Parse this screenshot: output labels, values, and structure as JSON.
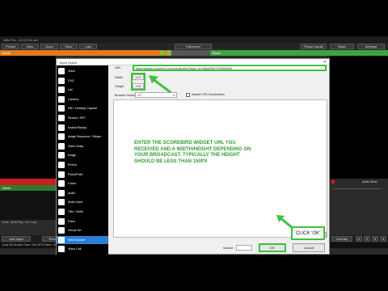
{
  "app": {
    "title": "vMix Pro - 19.0.0.54 x64",
    "toolbar": [
      "Preset",
      "New",
      "Open",
      "Save",
      "Last"
    ],
    "fullscreen_label": "Fullscreen",
    "right_toolbar": [
      "Pause Inputs",
      "Basic",
      "Settings"
    ],
    "preview_header": "Blank",
    "output_header": "Blank",
    "status_text": "(ms) 25 Render Time: 2ms GPU Mem: 7% CPU vMix: 1% Total: 7%",
    "colors": {
      "green": "#3ec13e",
      "orange": "#e07a1e",
      "select_blue": "#2b7ed6"
    }
  },
  "dialog": {
    "title": "Input Select",
    "input_types": [
      {
        "label": "Video",
        "icon": "film-icon"
      },
      {
        "label": "DVD",
        "icon": "disc-icon"
      },
      {
        "label": "List",
        "icon": "list-icon"
      },
      {
        "label": "Camera",
        "icon": "camera-icon"
      },
      {
        "label": "NDI / Desktop Capture",
        "icon": "monitor-icon"
      },
      {
        "label": "Stream / SRT",
        "icon": "stream-icon"
      },
      {
        "label": "Instant Replay",
        "icon": "replay-icon"
      },
      {
        "label": "Image Sequence / Slinger",
        "icon": "images-icon"
      },
      {
        "label": "Video Delay",
        "icon": "clock-icon"
      },
      {
        "label": "Image",
        "icon": "image-icon"
      },
      {
        "label": "Photos",
        "icon": "photos-icon"
      },
      {
        "label": "PowerPoint",
        "icon": "powerpoint-icon"
      },
      {
        "label": "Colour",
        "icon": "colour-icon"
      },
      {
        "label": "Audio",
        "icon": "audio-icon"
      },
      {
        "label": "Audio Input",
        "icon": "mic-icon"
      },
      {
        "label": "Title / XAML",
        "icon": "title-icon"
      },
      {
        "label": "Flash",
        "icon": "flash-icon"
      },
      {
        "label": "Virtual Set",
        "icon": "virtualset-icon"
      },
      {
        "label": "Web Browser",
        "icon": "globe-icon",
        "selected": true
      },
      {
        "label": "Video Call",
        "icon": "videocall-icon"
      }
    ],
    "url_label": "URL",
    "url_value": "https://widget.scorebird.com/overlay.html?team_id=2f8ad20677f10f3093a0",
    "width_label": "Width",
    "width_value": "1920",
    "height_label": "Height",
    "height_value": "1080",
    "browser_version_label": "Browser Version",
    "browser_version_value": "v77",
    "gpu_accel_label": "Disable GPU Acceleration",
    "clear_label": "Clear",
    "number_label": "Number",
    "ok_label": "OK",
    "cancel_label": "Cancel"
  },
  "annotations": {
    "note": "ENTER THE SCOREBIRD WIDGET URL YOU RECEIVED AND A WIDTH/HEIGHT DEPENDING ON YOUR BROADCAST. TYPICALLY THE HEIGHT SHOULD BE LESS THAN 150PX",
    "callout": "CLICK 'OK'"
  },
  "bottom": {
    "add_input": "Add Input",
    "buttons": [
      "Record",
      "External",
      "Stream",
      "MultiCorder",
      "PlayList",
      "Overlay"
    ],
    "side_items": [
      "Close",
      "Quick Play",
      "Cut",
      "Loop"
    ],
    "audio_mixer_label": "Audio Mixer"
  }
}
